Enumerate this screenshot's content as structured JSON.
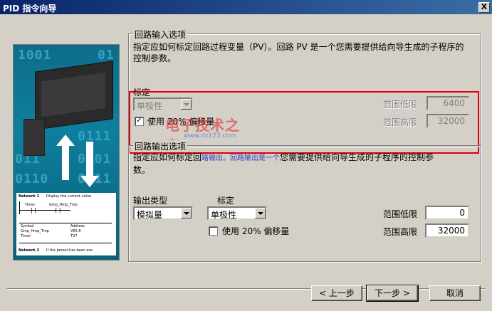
{
  "window": {
    "title": "PID 指令向导",
    "close_label": "X"
  },
  "illustration": {
    "binary_rows": [
      "1001",
      "01",
      "0111",
      "011",
      "0101",
      "0110",
      "0111"
    ],
    "ladder": {
      "network1": "Network 1",
      "network1_comment": "Display the current value",
      "network2": "Network 2",
      "network2_comment": "If the preset has been exc",
      "contact": "Timer",
      "coil": "Gmp_Hmp_Tmp",
      "table_header_symbol": "Symbol",
      "table_header_address": "Address",
      "table_row1_symbol": "Gmp_Hmp_Tmp",
      "table_row1_address": "V65.6",
      "table_row2_symbol": "Timer",
      "table_row2_address": "T37"
    }
  },
  "input_group": {
    "title": "回路输入选项",
    "description": "指定应如何标定回路过程变量（PV）。回路 PV 是一个您需要提供给向导生成的子程序的控制参数。",
    "scale_label": "标定",
    "scale_select_value": "单极性",
    "offset_label": "使用 20% 偏移量",
    "offset_checked": true,
    "range_low_label": "范围低限",
    "range_low_value": "6400",
    "range_high_label": "范围高限",
    "range_high_value": "32000"
  },
  "output_group": {
    "title": "回路输出选项",
    "description_line1_prefix": "指定应如何标定回",
    "description_line1_overlap": "路输出。回路输出是一个",
    "description_line1_suffix": "您需要提供给向导生成的子程序的控制参",
    "description_line2": "数。",
    "output_type_label": "输出类型",
    "output_type_value": "模拟量",
    "scale_label": "标定",
    "scale_select_value": "单极性",
    "offset_label": "使用 20% 偏移量",
    "offset_checked": false,
    "range_low_label": "范围低限",
    "range_low_value": "0",
    "range_high_label": "范围高限",
    "range_high_value": "32000"
  },
  "watermark": {
    "main": "电子技术之家",
    "sub": "www.dz123.com"
  },
  "buttons": {
    "back": "< 上一步",
    "next": "下一步 >",
    "cancel": "取消"
  },
  "colors": {
    "title_bar": "#0a246a",
    "highlight_border": "#e00000",
    "dialog_bg": "#d4d0c8"
  }
}
